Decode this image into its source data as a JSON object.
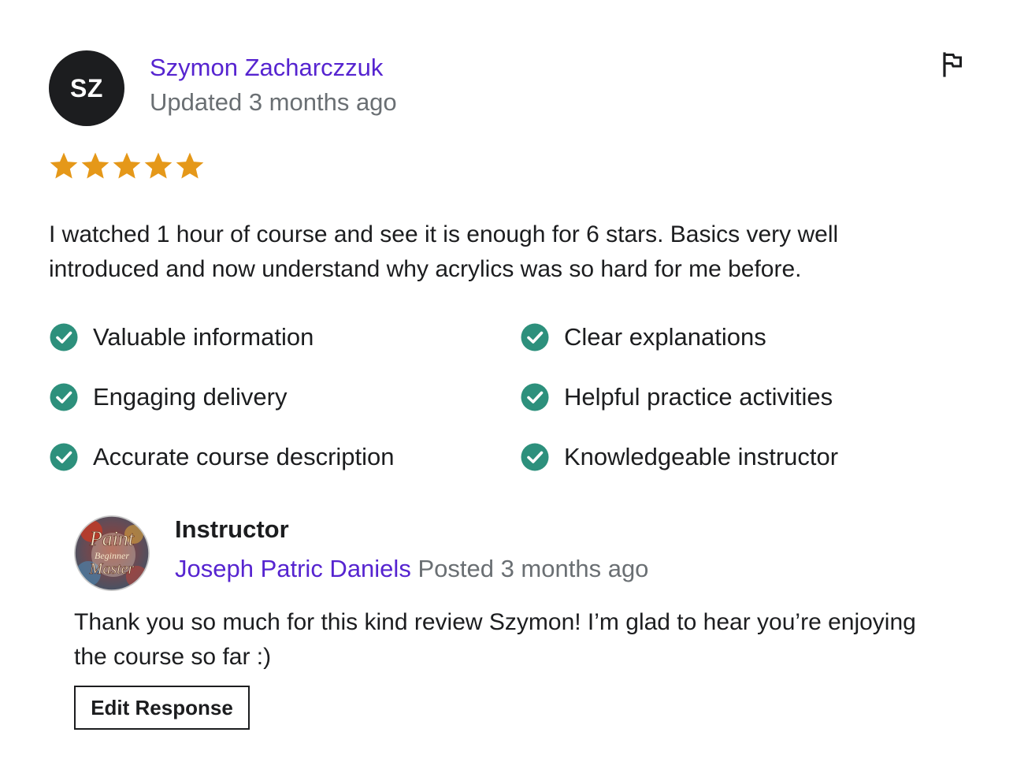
{
  "review": {
    "avatar_initials": "SZ",
    "reviewer_name": "Szymon Zacharczzuk",
    "updated_text": "Updated 3 months ago",
    "rating": 5,
    "rating_max": 5,
    "body": "I watched 1 hour of course and see it is enough for 6 stars. Basics very well introduced and now understand why acrylics was so hard for me before.",
    "flag_icon": "flag-icon"
  },
  "tags": [
    {
      "label": "Valuable information",
      "icon": "check-circle-icon"
    },
    {
      "label": "Clear explanations",
      "icon": "check-circle-icon"
    },
    {
      "label": "Engaging delivery",
      "icon": "check-circle-icon"
    },
    {
      "label": "Helpful practice activities",
      "icon": "check-circle-icon"
    },
    {
      "label": "Accurate course description",
      "icon": "check-circle-icon"
    },
    {
      "label": "Knowledgeable instructor",
      "icon": "check-circle-icon"
    }
  ],
  "response": {
    "role": "Instructor",
    "instructor_name": "Joseph Patric Daniels",
    "posted_text": "Posted 3 months ago",
    "avatar_logo_lines": [
      "Paint",
      "Beginner",
      "Master"
    ],
    "body": "Thank you so much for this kind review Szymon! I’m glad to hear you’re enjoying the course so far :)",
    "edit_button_label": "Edit Response"
  },
  "colors": {
    "link": "#5624d0",
    "muted": "#6a6f73",
    "star": "#e59819",
    "check": "#2d907c",
    "text": "#1c1d1f"
  }
}
